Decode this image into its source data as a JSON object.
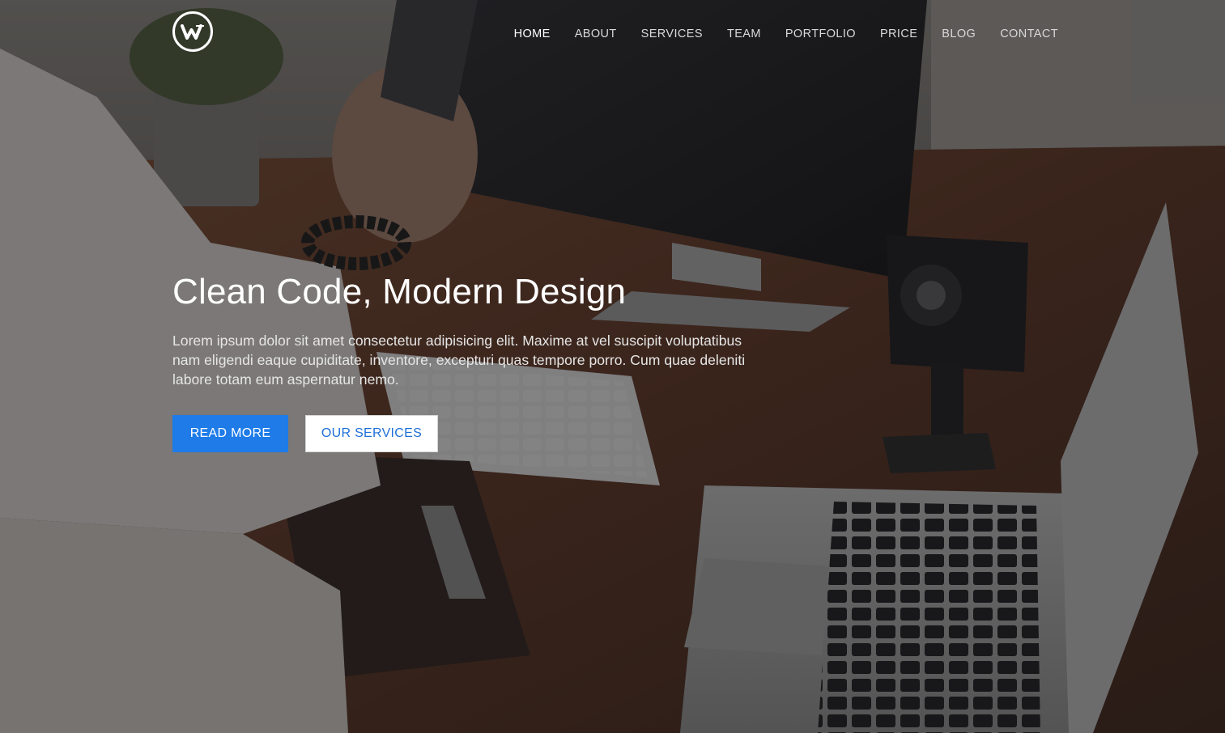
{
  "brand": {
    "logo_icon": "w-monogram-logo-icon",
    "logo_letter": "W"
  },
  "nav": {
    "items": [
      {
        "label": "HOME",
        "active": true
      },
      {
        "label": "ABOUT",
        "active": false
      },
      {
        "label": "SERVICES",
        "active": false
      },
      {
        "label": "TEAM",
        "active": false
      },
      {
        "label": "PORTFOLIO",
        "active": false
      },
      {
        "label": "PRICE",
        "active": false
      },
      {
        "label": "BLOG",
        "active": false
      },
      {
        "label": "CONTACT",
        "active": false
      }
    ]
  },
  "hero": {
    "title": "Clean Code, Modern Design",
    "text": "Lorem ipsum dolor sit amet consectetur adipisicing elit. Maxime at vel suscipit voluptatibus nam eligendi eaque cupiditate, inventore, excepturi quas tempore porro. Cum quae deleniti labore totam eum aspernatur nemo.",
    "primary_button": "READ MORE",
    "secondary_button": "OUR SERVICES"
  },
  "colors": {
    "accent": "#1e7be8",
    "overlay": "rgba(20,20,22,0.48)",
    "text": "#ffffff"
  }
}
